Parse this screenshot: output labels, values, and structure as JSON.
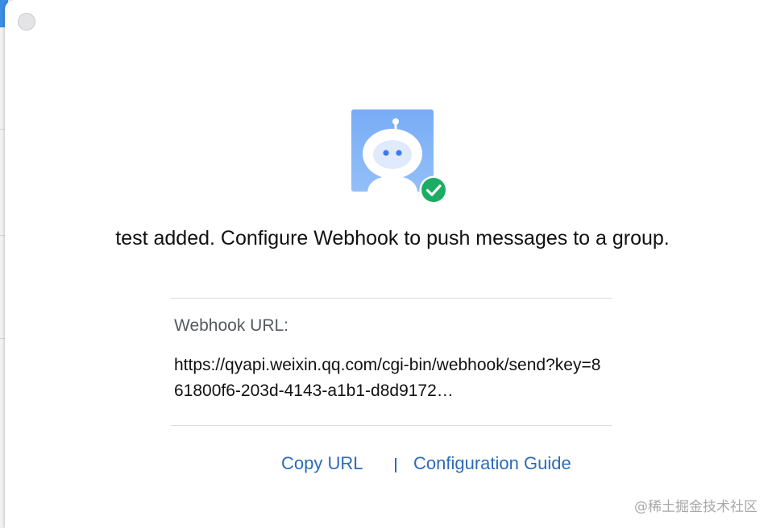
{
  "dialog": {
    "headline": "test added. Configure Webhook to push messages to a group.",
    "webhook_label": "Webhook URL:",
    "webhook_url": "https://qyapi.weixin.qq.com/cgi-bin/webhook/send?key=861800f6-203d-4143-a1b1-d8d9172…",
    "actions": {
      "copy_url": "Copy URL",
      "separator": "|",
      "configuration_guide": "Configuration Guide"
    }
  },
  "watermark": "@稀土掘金技术社区",
  "icons": {
    "close": "close-circle-icon",
    "avatar": "robot-avatar",
    "badge": "check-circle-icon"
  },
  "colors": {
    "link": "#2c6bb8",
    "success": "#1aad63",
    "avatar_bg": "#7ab0f5"
  }
}
